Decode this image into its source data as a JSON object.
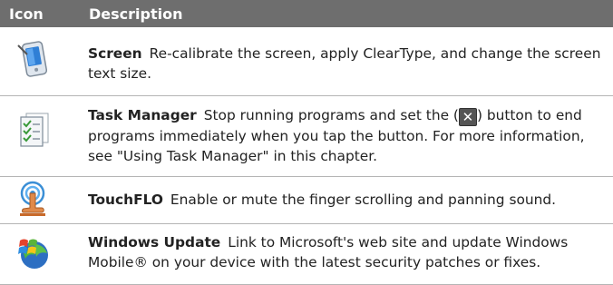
{
  "header": {
    "icon_col": "Icon",
    "desc_col": "Description"
  },
  "rows": [
    {
      "icon": "screen-pda-icon",
      "title": "Screen",
      "text": "Re-calibrate the screen, apply ClearType, and change the screen text size."
    },
    {
      "icon": "task-manager-icon",
      "title": "Task Manager",
      "text_before": "Stop running programs and set the (",
      "button_glyph": "✕",
      "text_after": ") button to end programs immediately when you tap the button. For more information, see \"Using Task Manager\" in this chapter."
    },
    {
      "icon": "touchflo-icon",
      "title": "TouchFLO",
      "text": "Enable or mute the finger scrolling and panning sound."
    },
    {
      "icon": "windows-update-icon",
      "title": "Windows Update",
      "text": "Link to Microsoft's web site and update Windows Mobile® on your device with the latest security patches or fixes."
    }
  ]
}
